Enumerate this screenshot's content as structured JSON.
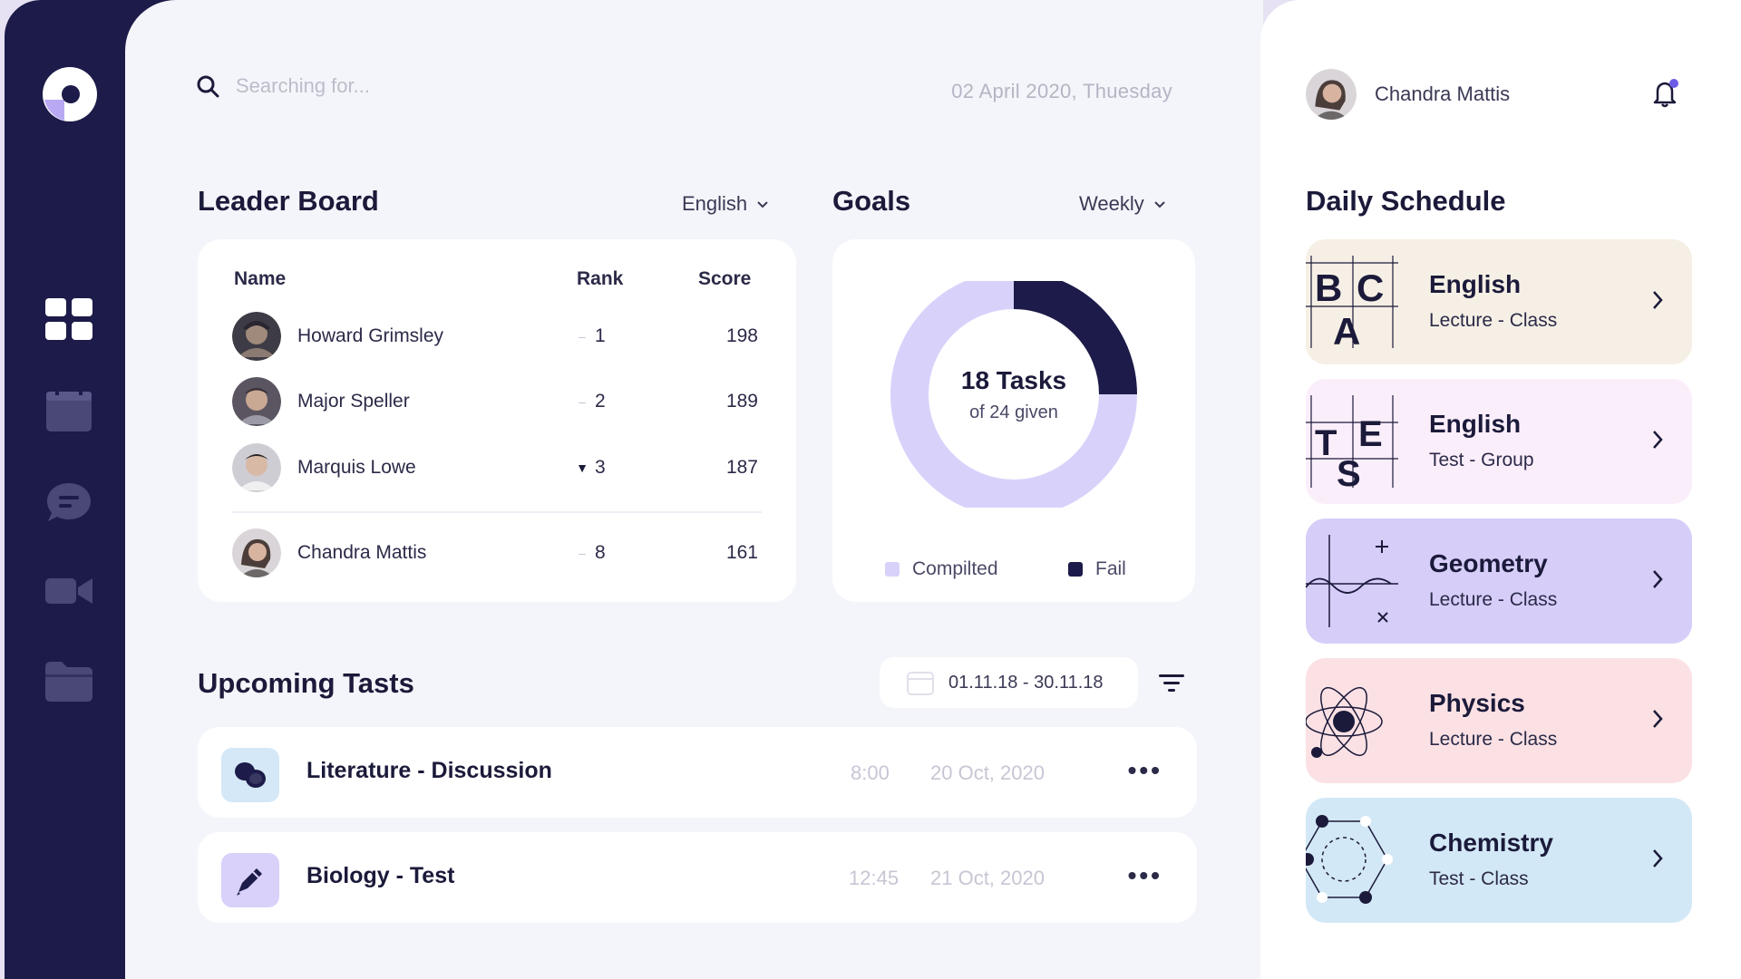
{
  "search": {
    "placeholder": "Searching for..."
  },
  "header": {
    "date": "02 April 2020, Thuesday"
  },
  "leaderboard": {
    "title": "Leader Board",
    "filter": "English",
    "columns": {
      "name": "Name",
      "rank": "Rank",
      "score": "Score"
    },
    "rows": [
      {
        "name": "Howard Grimsley",
        "rank": "1",
        "score": "198",
        "trend": "–"
      },
      {
        "name": "Major Speller",
        "rank": "2",
        "score": "189",
        "trend": "–"
      },
      {
        "name": "Marquis Lowe",
        "rank": "3",
        "score": "187",
        "trend": "▼"
      },
      {
        "name": "Chandra Mattis",
        "rank": "8",
        "score": "161",
        "trend": "–"
      }
    ]
  },
  "goals": {
    "title": "Goals",
    "filter": "Weekly",
    "center_main": "18 Tasks",
    "center_sub": "of 24 given",
    "completed": 18,
    "total": 24,
    "legend": {
      "completed": "Compilted",
      "fail": "Fail"
    },
    "colors": {
      "completed": "#d8d2fb",
      "fail": "#1c1b49",
      "track": "#efeff6"
    }
  },
  "upcoming": {
    "title": "Upcoming Tasts",
    "date_range": "01.11.18 - 30.11.18",
    "tasks": [
      {
        "title": "Literature - Discussion",
        "time": "8:00",
        "date": "20 Oct, 2020",
        "icon": "chat-bubbles-icon"
      },
      {
        "title": "Biology - Test",
        "time": "12:45",
        "date": "21 Oct, 2020",
        "icon": "pen-icon"
      }
    ]
  },
  "profile": {
    "name": "Chandra Mattis"
  },
  "schedule": {
    "title": "Daily Schedule",
    "items": [
      {
        "title": "English",
        "subtitle": "Lecture - Class",
        "color": "#f6efe5",
        "art": "letters-bca-icon"
      },
      {
        "title": "English",
        "subtitle": "Test - Group",
        "color": "#fbeefb",
        "art": "letters-tes-icon"
      },
      {
        "title": "Geometry",
        "subtitle": "Lecture - Class",
        "color": "#d6cdf9",
        "art": "graph-icon"
      },
      {
        "title": "Physics",
        "subtitle": "Lecture - Class",
        "color": "#fbe1e4",
        "art": "atom-icon"
      },
      {
        "title": "Chemistry",
        "subtitle": "Test - Class",
        "color": "#d3e8f6",
        "art": "molecule-icon"
      }
    ]
  }
}
